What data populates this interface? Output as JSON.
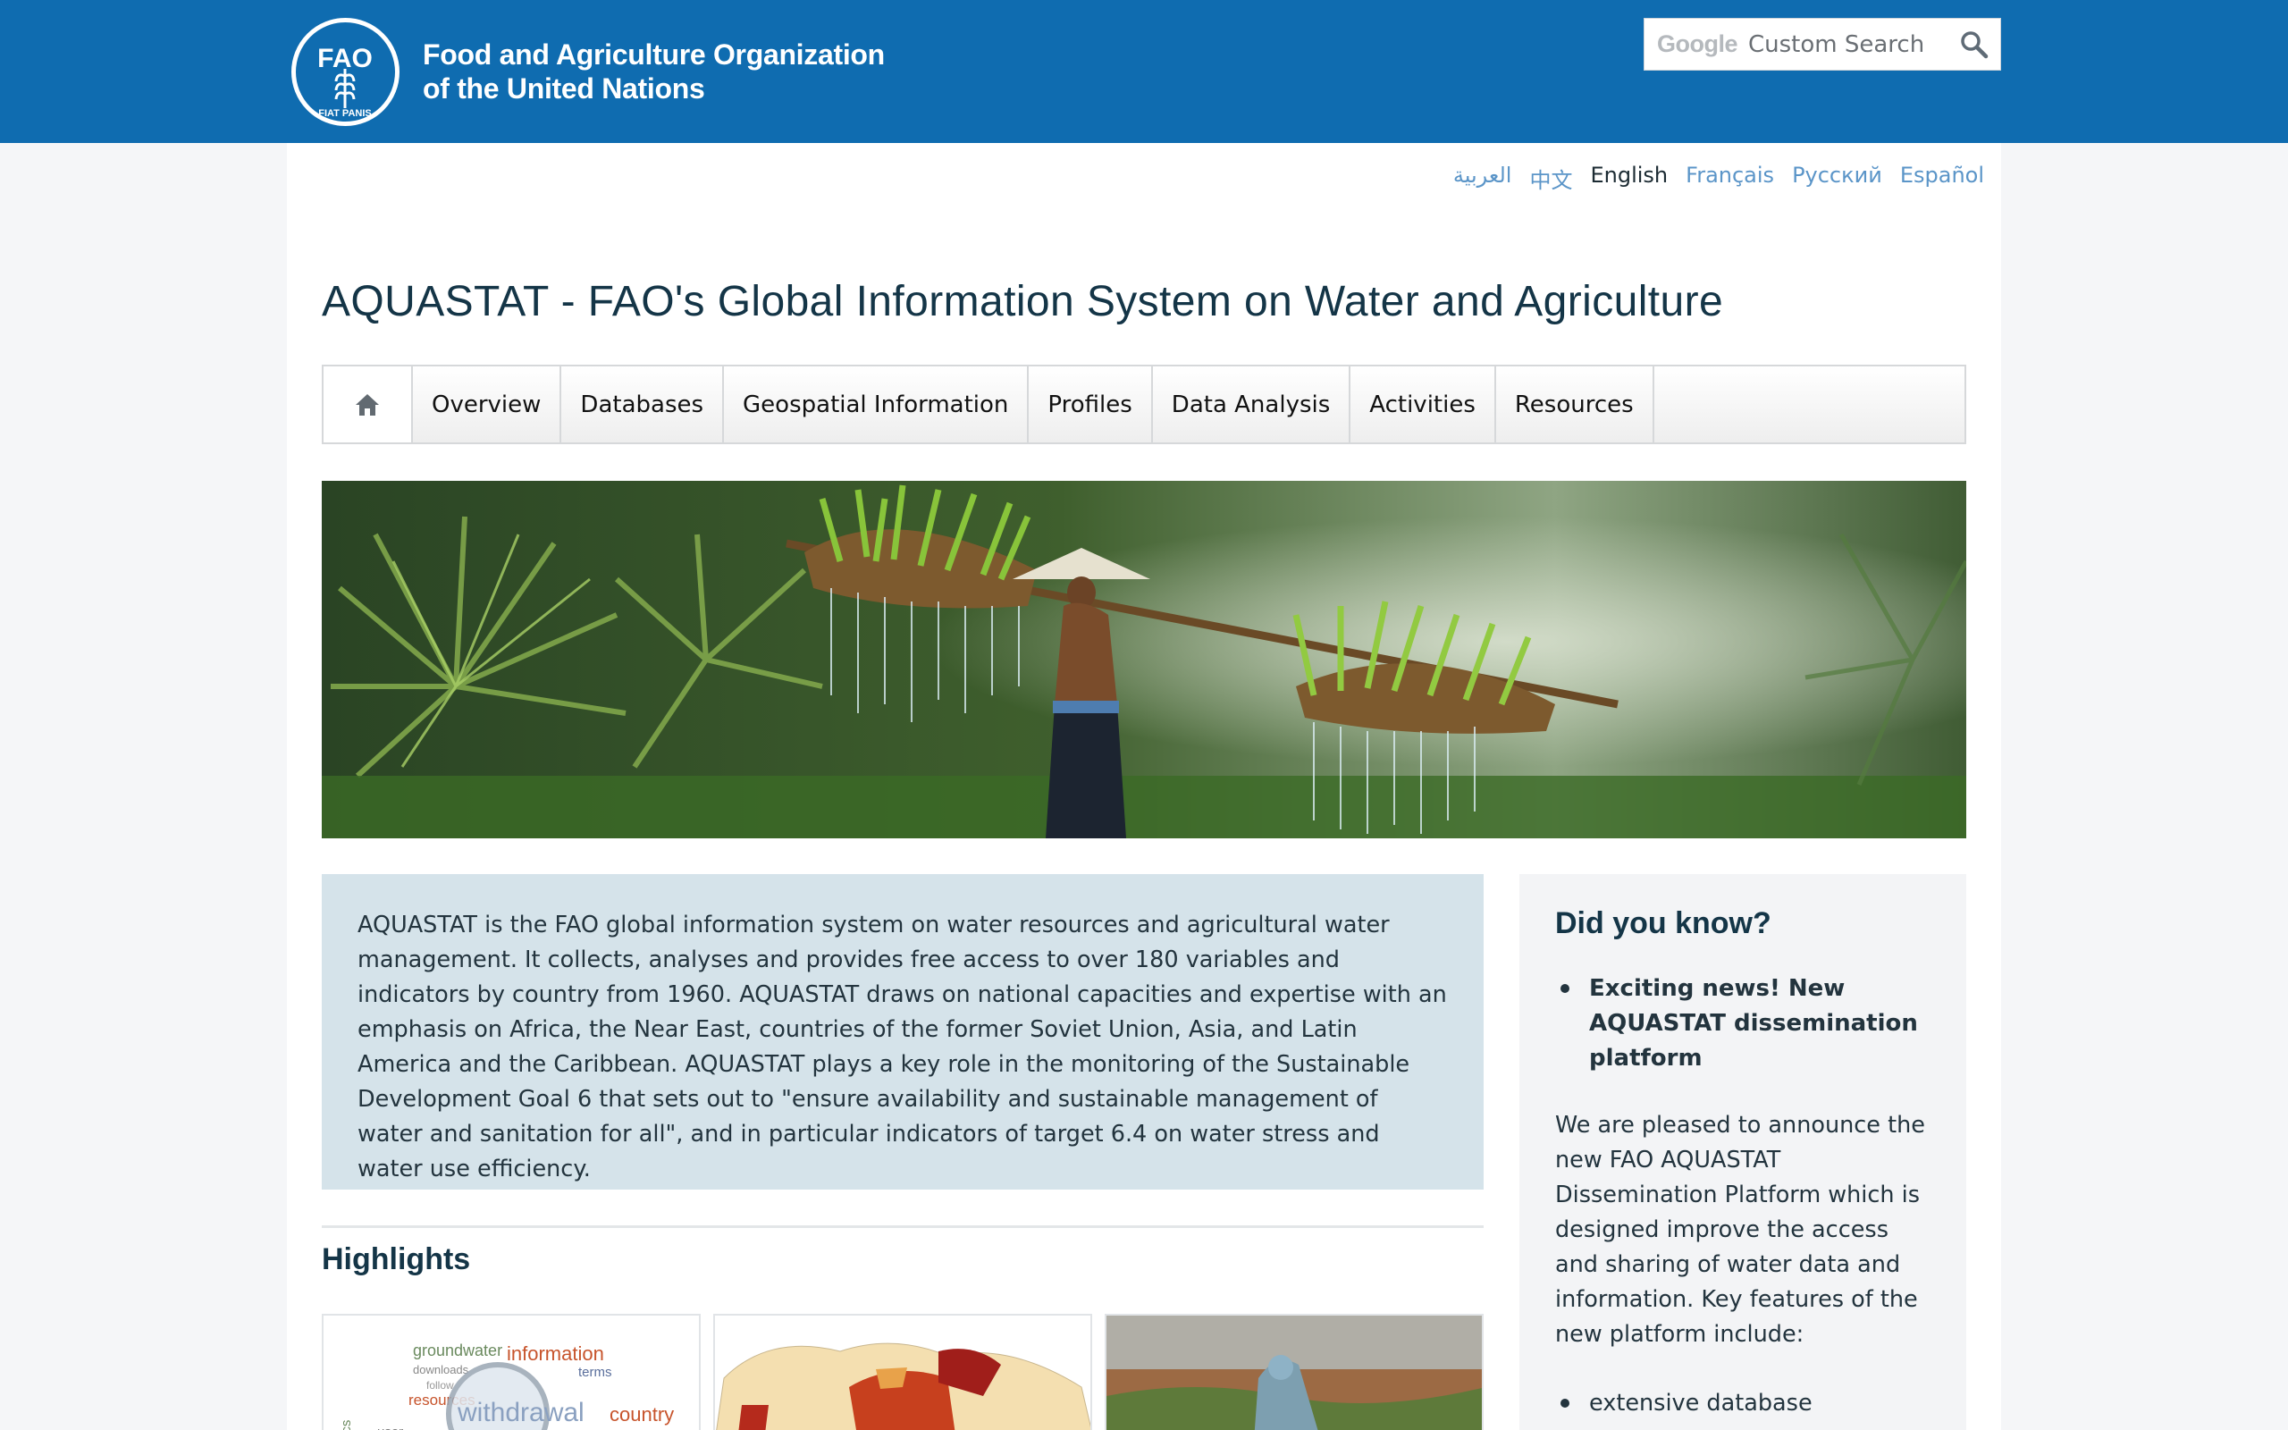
{
  "header": {
    "org_name_line1": "Food and Agriculture Organization",
    "org_name_line2": "of the United Nations",
    "logo_text": "FAO",
    "logo_motto": "FIAT PANIS",
    "search_brand": "Google",
    "search_placeholder": "Custom Search",
    "brand_color": "#0f6cb0"
  },
  "languages": [
    {
      "label": "العربية",
      "active": false
    },
    {
      "label": "中文",
      "active": false
    },
    {
      "label": "English",
      "active": true
    },
    {
      "label": "Français",
      "active": false
    },
    {
      "label": "Русский",
      "active": false
    },
    {
      "label": "Español",
      "active": false
    }
  ],
  "page_title": "AQUASTAT - FAO's Global Information System on Water and Agriculture",
  "nav": {
    "home_icon": "home-icon",
    "items": [
      "Overview",
      "Databases",
      "Geospatial Information",
      "Profiles",
      "Data Analysis",
      "Activities",
      "Resources"
    ]
  },
  "intro_text": "AQUASTAT is the FAO global information system on water resources and agricultural water management. It collects, analyses and provides free access to over 180 variables and indicators by country from 1960. AQUASTAT draws on national capacities and expertise with an emphasis on Africa, the Near East, countries of the former Soviet Union, Asia, and Latin America and the Caribbean. AQUASTAT plays a key role in the monitoring of the Sustainable Development Goal 6 that sets out to \"ensure availability and sustainable management of water and sanitation for all\", and in particular indicators of target 6.4 on water stress and water use efficiency.",
  "highlights": {
    "title": "Highlights",
    "card1_words": [
      "groundwater",
      "information",
      "downloads",
      "terms",
      "follow",
      "resources",
      "withdrawal",
      "country",
      "user",
      "ics"
    ]
  },
  "sidebar": {
    "title": "Did you know?",
    "news_item": "Exciting news! New AQUASTAT dissemination platform",
    "paragraph": "We are pleased to announce the new FAO AQUASTAT Dissemination Platform which is designed improve the access and sharing of water data and information. Key features of the new platform include:",
    "feature_1": "extensive database"
  }
}
